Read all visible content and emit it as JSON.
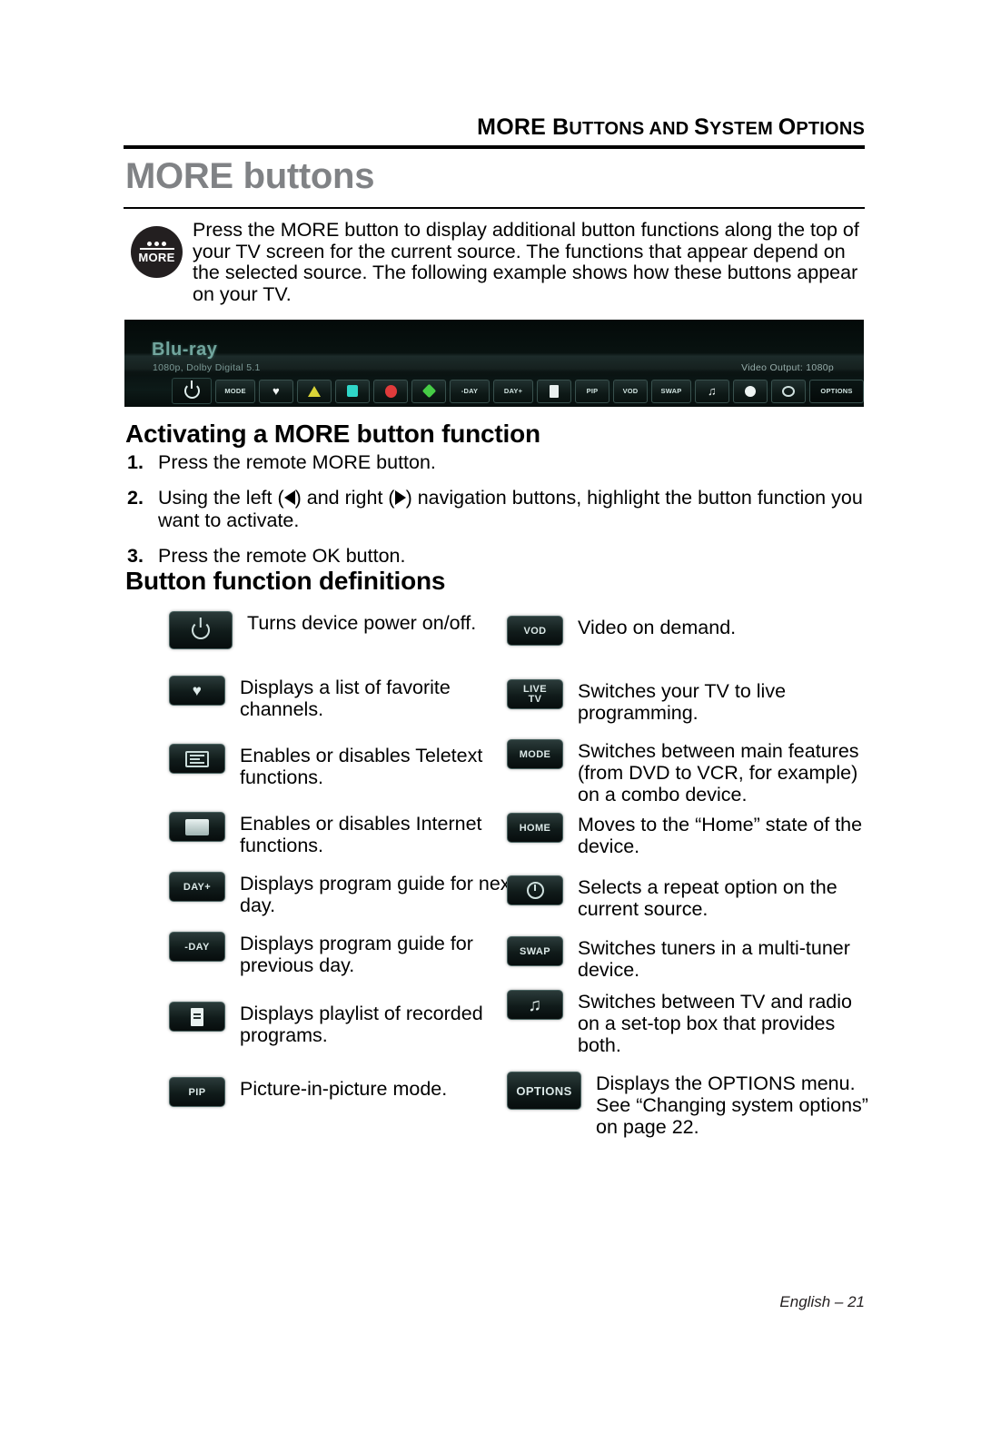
{
  "header": {
    "running_head_parts": [
      {
        "text": "MORE",
        "caps": "big"
      },
      {
        "text": " B",
        "caps": "big"
      },
      {
        "text": "UTTONS AND ",
        "caps": "small"
      },
      {
        "text": "S",
        "caps": "big"
      },
      {
        "text": "YSTEM ",
        "caps": "small"
      },
      {
        "text": "O",
        "caps": "big"
      },
      {
        "text": "PTIONS",
        "caps": "small"
      }
    ],
    "running_head": "MORE BUTTONS AND SYSTEM OPTIONS",
    "page_title": "MORE buttons"
  },
  "intro": {
    "icon_label": "MORE",
    "text": "Press the MORE button to display additional button functions along the top of your TV screen for the current source. The functions that appear depend on the selected source. The following example shows how these buttons appear on your TV."
  },
  "tv_screenshot": {
    "source_title": "Blu-ray",
    "source_info": "1080p, Dolby Digital 5.1",
    "video_output": "Video Output: 1080p",
    "buttons": [
      {
        "name": "power",
        "label": "",
        "glyph": "power"
      },
      {
        "name": "mode",
        "label": "MODE",
        "glyph": "text"
      },
      {
        "name": "favorites",
        "label": "",
        "glyph": "heart"
      },
      {
        "name": "yellow-triangle",
        "label": "",
        "glyph": "triangle",
        "color": "#d9d437"
      },
      {
        "name": "cyan-square",
        "label": "",
        "glyph": "square",
        "color": "#2fd6c8"
      },
      {
        "name": "red-circle",
        "label": "",
        "glyph": "circle",
        "color": "#e03b3b"
      },
      {
        "name": "green-diamond",
        "label": "",
        "glyph": "diamond",
        "color": "#46cc46"
      },
      {
        "name": "prev-day",
        "label": "-DAY",
        "glyph": "text"
      },
      {
        "name": "next-day",
        "label": "DAY+",
        "glyph": "text"
      },
      {
        "name": "playlist",
        "label": "",
        "glyph": "list"
      },
      {
        "name": "pip",
        "label": "PIP",
        "glyph": "text"
      },
      {
        "name": "vod",
        "label": "VOD",
        "glyph": "text"
      },
      {
        "name": "swap",
        "label": "SWAP",
        "glyph": "text"
      },
      {
        "name": "tv-radio",
        "label": "",
        "glyph": "note"
      },
      {
        "name": "record",
        "label": "",
        "glyph": "dot"
      },
      {
        "name": "repeat",
        "label": "",
        "glyph": "repeat"
      },
      {
        "name": "options",
        "label": "OPTIONS",
        "glyph": "text"
      },
      {
        "name": "misc",
        "label": "",
        "glyph": "misc"
      }
    ]
  },
  "activating": {
    "heading": "Activating a MORE button function",
    "steps": [
      {
        "num": "1.",
        "pre": "Press the remote MORE button.",
        "mid": "",
        "post": ""
      },
      {
        "num": "2.",
        "pre": "Using the left (",
        "mid": ") and right (",
        "post": ") navigation buttons, highlight the button function you want to activate."
      },
      {
        "num": "3.",
        "pre": "Press the remote OK button.",
        "mid": "",
        "post": ""
      }
    ]
  },
  "definitions": {
    "heading": "Button function definitions",
    "left_column": [
      {
        "button_label": "",
        "icon": "power",
        "text": "Turns device power on/off."
      },
      {
        "button_label": "",
        "icon": "heart",
        "text": "Displays a list of favorite channels."
      },
      {
        "button_label": "",
        "icon": "teletext",
        "text": "Enables or disables Teletext functions."
      },
      {
        "button_label": "",
        "icon": "internet",
        "text": "Enables or disables Internet functions."
      },
      {
        "button_label": "DAY+",
        "icon": "text",
        "text": "Displays program guide for next day."
      },
      {
        "button_label": "-DAY",
        "icon": "text",
        "text": "Displays program guide for previous day."
      },
      {
        "button_label": "",
        "icon": "playlist",
        "text": "Displays playlist of recorded programs."
      },
      {
        "button_label": "PIP",
        "icon": "text",
        "text": "Picture-in-picture mode."
      }
    ],
    "right_column": [
      {
        "button_label": "VOD",
        "icon": "text",
        "text": "Video on demand."
      },
      {
        "button_label": "LIVE TV",
        "icon": "text2",
        "text": "Switches your TV to live programming."
      },
      {
        "button_label": "MODE",
        "icon": "text",
        "text": "Switches between main features (from DVD to VCR, for example) on a combo device."
      },
      {
        "button_label": "HOME",
        "icon": "text",
        "text": "Moves to the “Home” state of the device."
      },
      {
        "button_label": "",
        "icon": "repeat",
        "text": "Selects a repeat option on the current source."
      },
      {
        "button_label": "SWAP",
        "icon": "text",
        "text": "Switches tuners in a multi-tuner device."
      },
      {
        "button_label": "",
        "icon": "note",
        "text": "Switches between TV and radio on a set-top box that provides both."
      },
      {
        "button_label": "OPTIONS",
        "icon": "text",
        "text": "Displays the OPTIONS menu. See “Changing system options” on page 22."
      }
    ]
  },
  "footer": {
    "text": "English – 21"
  }
}
